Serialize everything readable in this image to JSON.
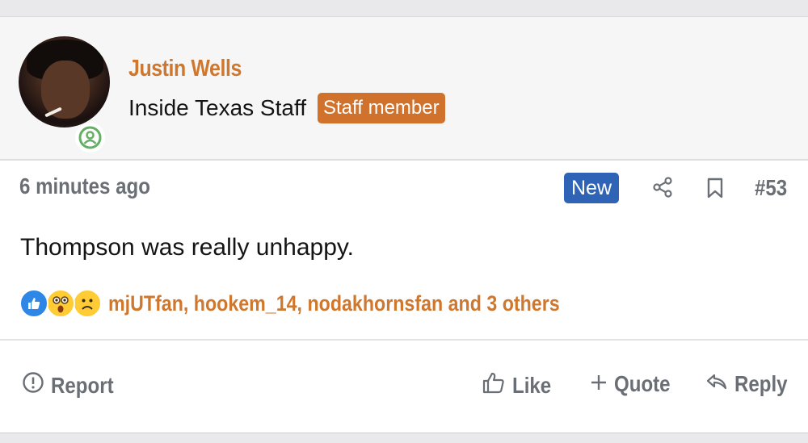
{
  "user": {
    "name": "Justin Wells",
    "title": "Inside Texas Staff",
    "badge": "Staff member"
  },
  "post": {
    "timestamp": "6 minutes ago",
    "new_badge": "New",
    "number": "#53",
    "message": "Thompson was really unhappy."
  },
  "reactions": {
    "icons": [
      "like-icon",
      "wow-icon",
      "sad-icon"
    ],
    "users_text": "mjUTfan, hookem_14, nodakhornsfan and 3 others"
  },
  "actions": {
    "report": "Report",
    "like": "Like",
    "quote": "Quote",
    "reply": "Reply"
  },
  "colors": {
    "username": "#d0772e",
    "staff_badge": "#d0722c",
    "new_badge": "#2f63b5",
    "muted": "#6a6f76",
    "online": "#63b064"
  }
}
